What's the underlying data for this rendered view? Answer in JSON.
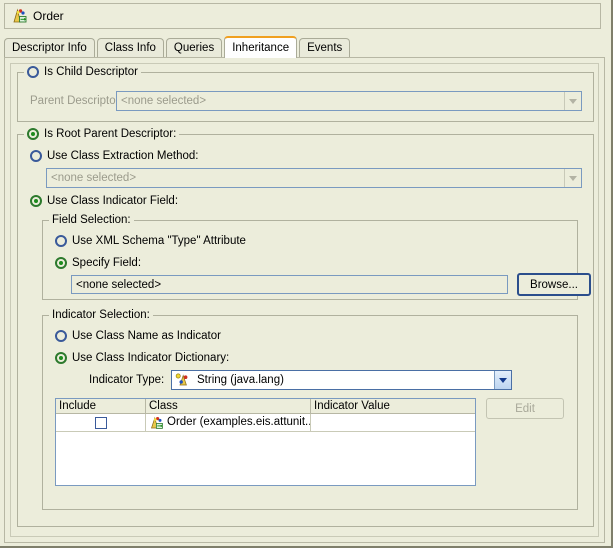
{
  "window": {
    "title": "Order",
    "title_icon": "descriptor-icon"
  },
  "tabs": [
    {
      "label": "Descriptor Info",
      "selected": false
    },
    {
      "label": "Class Info",
      "selected": false
    },
    {
      "label": "Queries",
      "selected": false
    },
    {
      "label": "Inheritance",
      "selected": true
    },
    {
      "label": "Events",
      "selected": false
    }
  ],
  "colors": {
    "background": "#eceddb",
    "selected_tab_accent": "#f0a020",
    "radio_unselected": "#3a5a9a",
    "radio_selected": "#1d8c1d",
    "field_border": "#7a9ac0",
    "disabled_text": "#9b9b8c"
  },
  "child_descriptor_group": {
    "radio_label": "Is Child Descriptor",
    "selected": false,
    "parent_descriptor_label": "Parent Descriptor:",
    "parent_descriptor_value": "<none selected>",
    "enabled": false
  },
  "root_parent_group": {
    "radio_label": "Is Root Parent Descriptor:",
    "selected": true,
    "extraction_method": {
      "radio_label": "Use Class Extraction Method:",
      "selected": false,
      "value": "<none selected>",
      "enabled": false
    },
    "indicator_field": {
      "radio_label": "Use Class Indicator Field:",
      "selected": true
    },
    "field_selection": {
      "legend": "Field Selection:",
      "xml_schema_type": {
        "label": "Use XML Schema \"Type\" Attribute",
        "selected": false
      },
      "specify_field": {
        "label": "Specify Field:",
        "selected": true,
        "value": "<none selected>",
        "browse_label": "Browse..."
      }
    },
    "indicator_selection": {
      "legend": "Indicator Selection:",
      "class_name_as_indicator": {
        "label": "Use Class Name as Indicator",
        "selected": false
      },
      "class_indicator_dictionary": {
        "label": "Use Class Indicator Dictionary:",
        "selected": true
      },
      "indicator_type": {
        "label": "Indicator Type:",
        "value": "String (java.lang)",
        "icon": "string-type-icon"
      },
      "table": {
        "columns": [
          "Include",
          "Class",
          "Indicator Value"
        ],
        "rows": [
          {
            "include": false,
            "class_icon": "descriptor-icon",
            "class": "Order (examples.eis.attunit...",
            "indicator_value": ""
          }
        ]
      },
      "edit_button": {
        "label": "Edit",
        "enabled": false
      }
    }
  }
}
